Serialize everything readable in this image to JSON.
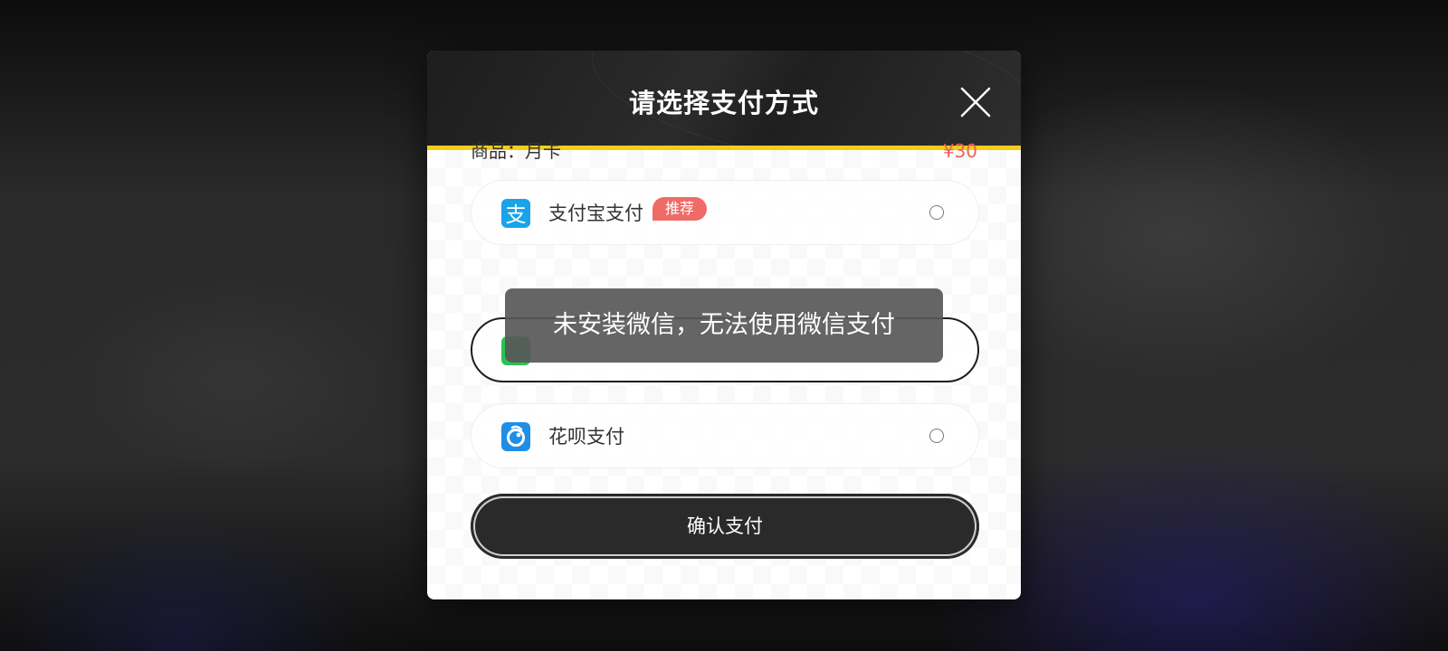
{
  "dialog": {
    "title": "请选择支付方式",
    "accent_color": "#f2cd1a"
  },
  "product": {
    "label": "商品：月卡",
    "price": "¥30",
    "price_color": "#e8625a"
  },
  "payment_options": [
    {
      "label": "支付宝支付",
      "icon": "alipay-icon",
      "icon_color": "#1aa3e8",
      "badge": "推荐",
      "selected": false
    },
    {
      "label": "",
      "icon": "wechat-pay-icon",
      "icon_color": "#2bc255",
      "selected": true
    },
    {
      "label": "花呗支付",
      "icon": "huabei-icon",
      "icon_color": "#1f8ee6",
      "selected": false
    }
  ],
  "confirm": {
    "label": "确认支付"
  },
  "toast": {
    "message": "未安装微信，无法使用微信支付"
  }
}
